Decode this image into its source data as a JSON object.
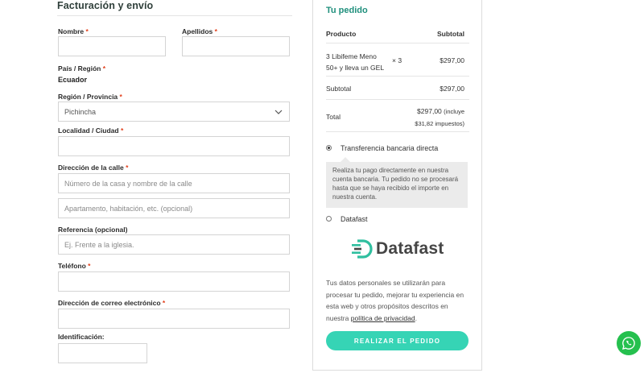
{
  "billing": {
    "title": "Facturación y envío",
    "nombre_label": "Nombre",
    "apellidos_label": "Apellidos",
    "pais_label": "País / Región",
    "pais_value": "Ecuador",
    "region_label": "Región / Provincia",
    "region_value": "Pichincha",
    "localidad_label": "Localidad / Ciudad",
    "direccion_label": "Dirección de la calle",
    "direccion_placeholder": "Número de la casa y nombre de la calle",
    "direccion2_placeholder": "Apartamento, habitación, etc. (opcional)",
    "referencia_label": "Referencia (opcional)",
    "referencia_placeholder": "Ej. Frente a la iglesia.",
    "telefono_label": "Teléfono",
    "email_label": "Dirección de correo electrónico",
    "identificacion_label": "Identificación:",
    "required_mark": "*"
  },
  "order": {
    "title": "Tu pedido",
    "col_product": "Producto",
    "col_subtotal": "Subtotal",
    "item_name_line1": "3 Libifeme Meno",
    "item_name_line2": "50+ y lleva un GEL",
    "item_qty": "× 3",
    "item_subtotal": "$297,00",
    "subtotal_label": "Subtotal",
    "subtotal_value": "$297,00",
    "total_label": "Total",
    "total_value": "$297,00",
    "total_note1": "(incluye",
    "total_note2": "$31,82 impuestos)"
  },
  "payment": {
    "option1_label": "Transferencia bancaria directa",
    "option1_desc": "Realiza tu pago directamente en nuestra cuenta bancaria. Tu pedido no se procesará hasta que se haya recibido el importe en nuestra cuenta.",
    "option2_label": "Datafast",
    "logo_text": "Datafast"
  },
  "privacy": {
    "text": "Tus datos personales se utilizarán para procesar tu pedido, mejorar tu experiencia en esta web y otros propósitos descritos en nuestra",
    "link": "política de privacidad",
    "end": "."
  },
  "place_order_label": "REALIZAR EL PEDIDO",
  "colors": {
    "accent": "#36d4b5",
    "title_green": "#1f8f7c",
    "required": "#e2401c",
    "whatsapp": "#25c04e"
  },
  "icons": {
    "select": "chevron-down-icon",
    "whatsapp": "whatsapp-icon",
    "logo": "datafast-logo-icon"
  }
}
